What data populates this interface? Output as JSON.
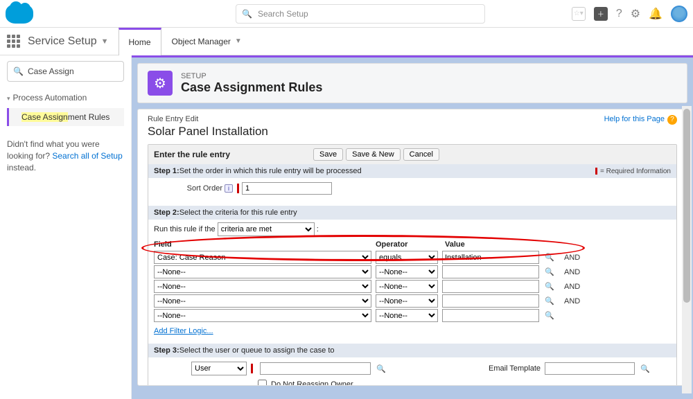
{
  "header": {
    "search_placeholder": "Search Setup"
  },
  "nav": {
    "setup_label": "Service Setup",
    "tabs": [
      {
        "label": "Home",
        "active": true
      },
      {
        "label": "Object Manager",
        "active": false
      }
    ]
  },
  "sidebar": {
    "search_value": "Case Assign",
    "group": "Process Automation",
    "items": [
      {
        "label_pre": "Case Assign",
        "label_post": "ment Rules",
        "selected": true
      }
    ],
    "note_pre": "Didn't find what you were looking for? ",
    "note_link": "Search all of Setup",
    "note_post": " instead."
  },
  "page": {
    "sup": "SETUP",
    "title": "Case Assignment Rules",
    "crumb": "Rule Entry Edit",
    "rule_title": "Solar Panel Installation",
    "help": "Help for this Page",
    "panel_title": "Enter the rule entry",
    "buttons": {
      "save": "Save",
      "save_new": "Save & New",
      "cancel": "Cancel"
    },
    "step1": {
      "label_pre": "Step 1:",
      "label": " Set the order in which this rule entry will be processed",
      "required": "= Required Information",
      "sort_label": "Sort Order",
      "sort_value": "1"
    },
    "step2": {
      "label_pre": "Step 2:",
      "label": " Select the criteria for this rule entry",
      "run_if_label": "Run this rule if the",
      "run_if_value": "criteria are met",
      "headers": {
        "field": "Field",
        "operator": "Operator",
        "value": "Value"
      },
      "rows": [
        {
          "field": "Case: Case Reason",
          "operator": "equals",
          "value": "Installation",
          "logic": "AND"
        },
        {
          "field": "--None--",
          "operator": "--None--",
          "value": "",
          "logic": "AND"
        },
        {
          "field": "--None--",
          "operator": "--None--",
          "value": "",
          "logic": "AND"
        },
        {
          "field": "--None--",
          "operator": "--None--",
          "value": "",
          "logic": "AND"
        },
        {
          "field": "--None--",
          "operator": "--None--",
          "value": "",
          "logic": ""
        }
      ],
      "add_logic": "Add Filter Logic..."
    },
    "step3": {
      "label_pre": "Step 3:",
      "label": " Select the user or queue to assign the case to",
      "assignee_type": "User",
      "assignee_value": "",
      "reassign_label": "Do Not Reassign Owner",
      "email_label": "Email Template",
      "email_value": ""
    }
  }
}
